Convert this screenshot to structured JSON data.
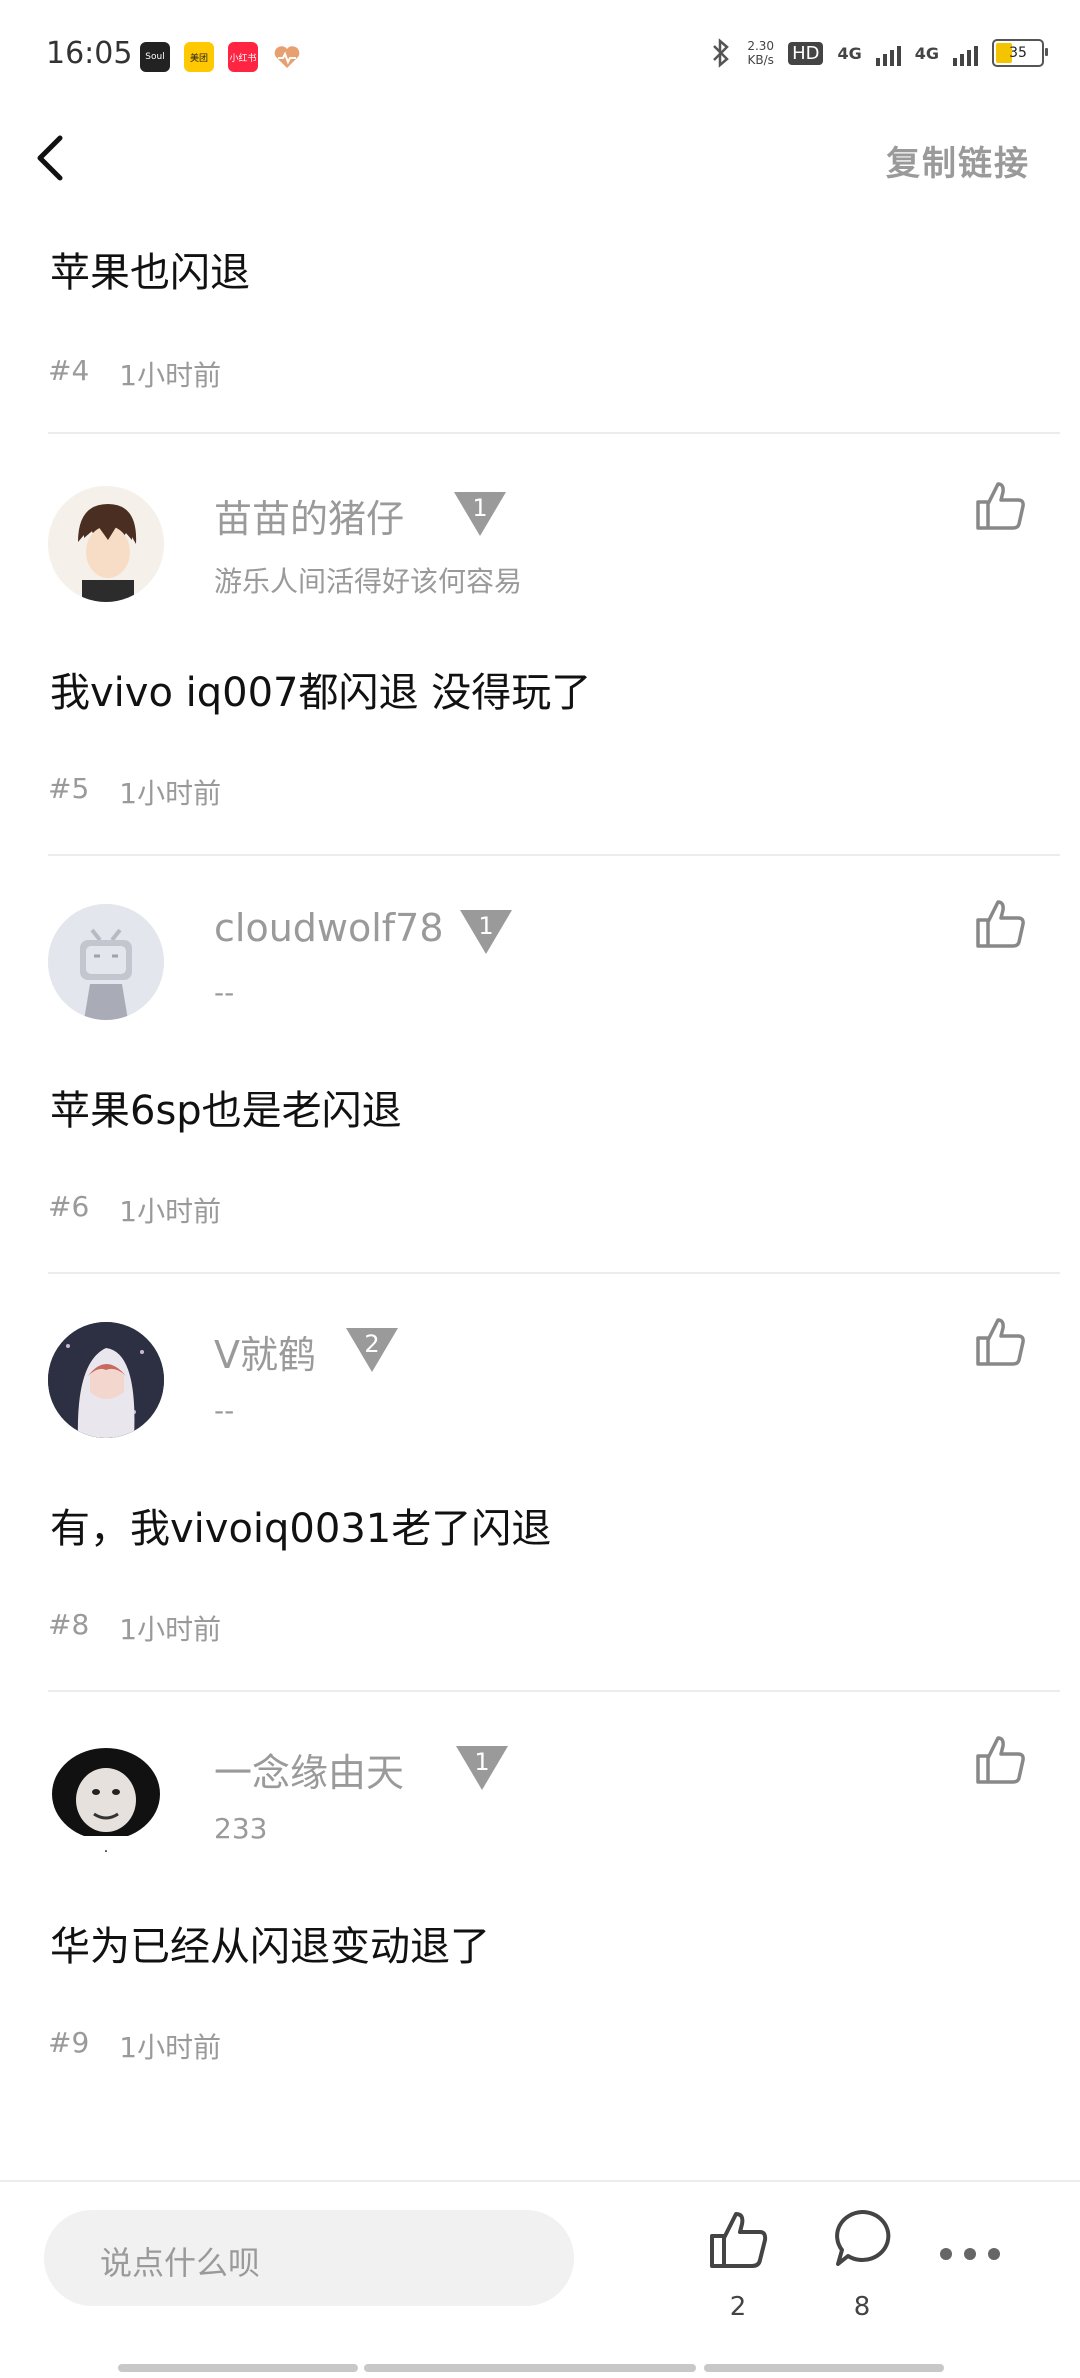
{
  "status_bar": {
    "time": "16:05",
    "net_speed_top": "2.30",
    "net_speed_bottom": "KB/s",
    "hd": "HD",
    "sim1": "4G",
    "sim2": "4G",
    "battery": "35",
    "apps": [
      "Soul",
      "美团",
      "小红书"
    ]
  },
  "header": {
    "copy_link": "复制链接"
  },
  "top_comment": {
    "text": "苹果也闪退",
    "floor": "#4",
    "time": "1小时前"
  },
  "comments": [
    {
      "username": "苗苗的猪仔",
      "level": "1",
      "signature": "游乐人间活得好该何容易",
      "text": "我vivo iq007都闪退 没得玩了",
      "floor": "#5",
      "time": "1小时前"
    },
    {
      "username": "cloudwolf78",
      "level": "1",
      "signature": "--",
      "text": "苹果6sp也是老闪退",
      "floor": "#6",
      "time": "1小时前"
    },
    {
      "username": "V就鹤",
      "level": "2",
      "signature": "--",
      "text": "有，我vivoiq0031老了闪退",
      "floor": "#8",
      "time": "1小时前"
    },
    {
      "username": "一念缘由天",
      "level": "1",
      "signature": "233",
      "text": "华为已经从闪退变动退了",
      "floor": "#9",
      "time": "1小时前"
    }
  ],
  "bottom_bar": {
    "input_placeholder": "说点什么呗",
    "like_count": "2",
    "comment_count": "8"
  },
  "colors": {
    "gray_text": "#9a9a9a",
    "divider": "#ececec",
    "input_bg": "#f1f1f1"
  }
}
